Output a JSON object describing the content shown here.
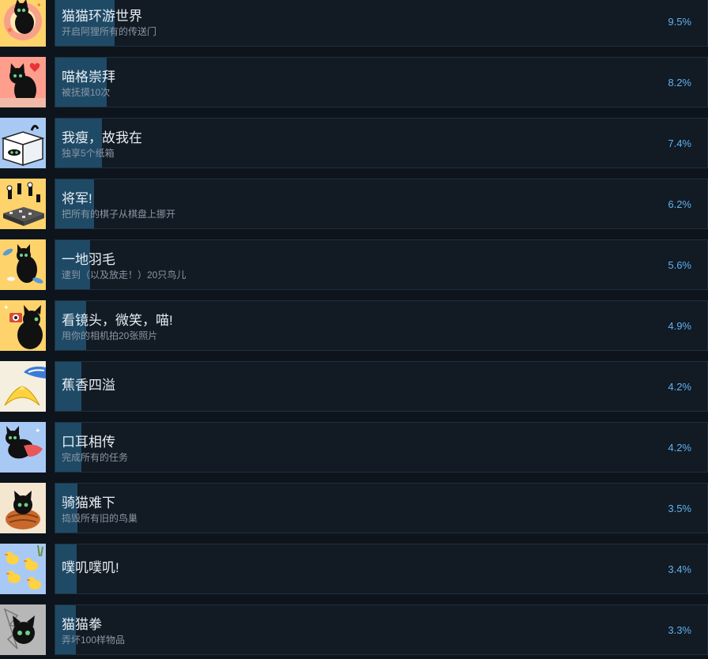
{
  "achievements": [
    {
      "title": "猫猫环游世界",
      "desc": "开启阿狸所有的传送门",
      "percent": "9.5%",
      "fill": 9.5,
      "icon": "cat-in-portal-icon",
      "bg": "#ffd36b"
    },
    {
      "title": "喵格崇拜",
      "desc": "被抚摸10次",
      "percent": "8.2%",
      "fill": 8.2,
      "icon": "cat-with-heart-icon",
      "bg": "#ff9e8c"
    },
    {
      "title": "我瘦，故我在",
      "desc": "独享5个纸箱",
      "percent": "7.4%",
      "fill": 7.4,
      "icon": "cat-in-box-icon",
      "bg": "#a9c9f5"
    },
    {
      "title": "将军!",
      "desc": "把所有的棋子从棋盘上挪开",
      "percent": "6.2%",
      "fill": 6.2,
      "icon": "chessboard-icon",
      "bg": "#ffd36b"
    },
    {
      "title": "一地羽毛",
      "desc": "逮到（以及放走！）20只鸟儿",
      "percent": "5.6%",
      "fill": 5.6,
      "icon": "cat-with-feathers-icon",
      "bg": "#ffd36b"
    },
    {
      "title": "看镜头，微笑，喵!",
      "desc": "用你的相机拍20张照片",
      "percent": "4.9%",
      "fill": 4.9,
      "icon": "cat-with-camera-icon",
      "bg": "#ffd36b"
    },
    {
      "title": "蕉香四溢",
      "desc": "",
      "percent": "4.2%",
      "fill": 4.2,
      "icon": "banana-peel-icon",
      "bg": "#f5efe0"
    },
    {
      "title": "口耳相传",
      "desc": "完成所有的任务",
      "percent": "4.2%",
      "fill": 4.2,
      "icon": "cat-with-scarf-icon",
      "bg": "#a9c9f5"
    },
    {
      "title": "骑猫难下",
      "desc": "捣毁所有旧的鸟巢",
      "percent": "3.5%",
      "fill": 3.5,
      "icon": "cat-in-nest-icon",
      "bg": "#f5e6d0"
    },
    {
      "title": "噗叽噗叽!",
      "desc": "",
      "percent": "3.4%",
      "fill": 3.4,
      "icon": "rubber-ducks-icon",
      "bg": "#a9c9f5"
    },
    {
      "title": "猫猫拳",
      "desc": "弄坏100样物品",
      "percent": "3.3%",
      "fill": 3.3,
      "icon": "cat-punch-icon",
      "bg": "#c9c9c9"
    }
  ]
}
